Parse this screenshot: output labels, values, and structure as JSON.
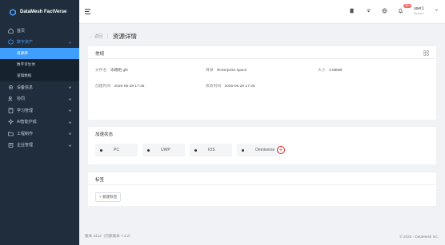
{
  "brand": {
    "name": "DataMesh FactVerse"
  },
  "sidebar": {
    "items": [
      {
        "label": "首页",
        "icon": "home-icon"
      },
      {
        "label": "数字资产",
        "icon": "box-icon"
      },
      {
        "label": "设备信息",
        "icon": "gear-icon"
      },
      {
        "label": "协同",
        "icon": "users-icon"
      },
      {
        "label": "学习管理",
        "icon": "book-icon"
      },
      {
        "label": "AI智能作成",
        "icon": "ai-icon"
      },
      {
        "label": "工程制作",
        "icon": "folder-icon"
      },
      {
        "label": "企业管理",
        "icon": "building-icon"
      }
    ],
    "sub_items": [
      {
        "label": "资源库"
      },
      {
        "label": "数字孪生体"
      },
      {
        "label": "逻辑数据"
      }
    ]
  },
  "header": {
    "badge": "99+",
    "user_name": "user1",
    "user_sub": "Student"
  },
  "page": {
    "back_label": "返回",
    "title": "资源详情"
  },
  "basic": {
    "title": "常规",
    "file_name_label": "文件名",
    "file_name": "冰箱柜.glb",
    "dir_label": "目录",
    "dir": "/Enterprise space",
    "size_label": "大小",
    "size": "3.88MB",
    "created_label": "创建时间",
    "created": "2025-06-28 17:36",
    "modified_label": "修改时间",
    "modified": "2025-06-28 17:36"
  },
  "accel": {
    "title": "加速状态",
    "chips": [
      {
        "label": "PC"
      },
      {
        "label": "UWP"
      },
      {
        "label": "IOS"
      },
      {
        "label": "Omniverse"
      }
    ],
    "add": "+"
  },
  "tags": {
    "title": "标签",
    "add_label": "+ 新建标签"
  },
  "footer": {
    "version": "版本 2412（内部版本 7.3.2）",
    "copyright": "© 2025 - DataMesh Inc."
  }
}
